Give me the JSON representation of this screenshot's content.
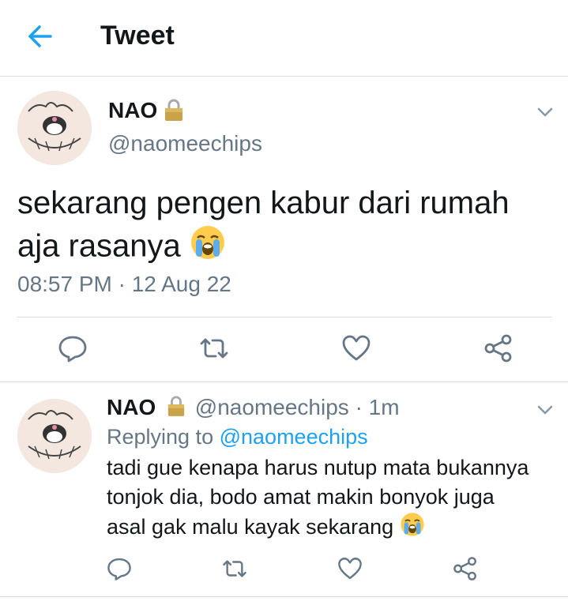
{
  "header": {
    "title": "Tweet",
    "back_icon": "arrow-left-icon",
    "accent": "#1da1f2"
  },
  "main_tweet": {
    "author_name": "NAO",
    "author_handle": "@naomeechips",
    "text": "sekarang pengen kabur dari rumah aja rasanya",
    "emoji": "loudly-crying-face",
    "timestamp": "08:57 PM · 12 Aug 22",
    "actions": [
      "reply-icon",
      "retweet-icon",
      "like-icon",
      "share-icon"
    ]
  },
  "reply_tweet": {
    "author_name": "NAO",
    "author_handle": "@naomeechips",
    "time_ago": "· 1m",
    "replying_prefix": "Replying to",
    "replying_handle": "@naomeechips",
    "line1": "tadi gue kenapa harus nutup mata bukannya",
    "line2": "tonjok dia, bodo amat makin bonyok juga",
    "line3": "asal gak malu kayak sekarang",
    "emoji": "loudly-crying-face",
    "actions": [
      "reply-icon",
      "retweet-icon",
      "like-icon",
      "share-icon"
    ]
  }
}
